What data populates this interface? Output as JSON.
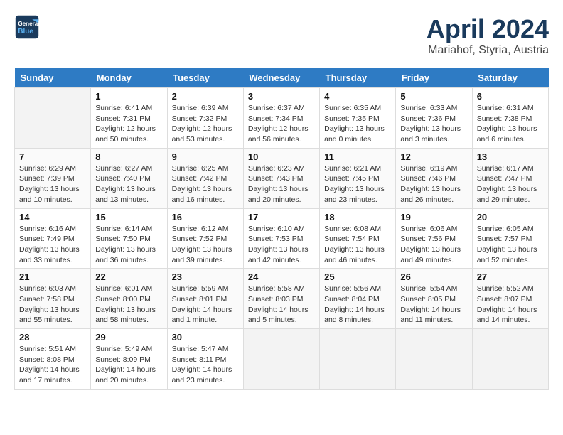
{
  "header": {
    "logo": {
      "line1": "General",
      "line2": "Blue"
    },
    "title": "April 2024",
    "location": "Mariahof, Styria, Austria"
  },
  "weekdays": [
    "Sunday",
    "Monday",
    "Tuesday",
    "Wednesday",
    "Thursday",
    "Friday",
    "Saturday"
  ],
  "weeks": [
    [
      {
        "day": null
      },
      {
        "day": "1",
        "sunrise": "Sunrise: 6:41 AM",
        "sunset": "Sunset: 7:31 PM",
        "daylight": "Daylight: 12 hours and 50 minutes."
      },
      {
        "day": "2",
        "sunrise": "Sunrise: 6:39 AM",
        "sunset": "Sunset: 7:32 PM",
        "daylight": "Daylight: 12 hours and 53 minutes."
      },
      {
        "day": "3",
        "sunrise": "Sunrise: 6:37 AM",
        "sunset": "Sunset: 7:34 PM",
        "daylight": "Daylight: 12 hours and 56 minutes."
      },
      {
        "day": "4",
        "sunrise": "Sunrise: 6:35 AM",
        "sunset": "Sunset: 7:35 PM",
        "daylight": "Daylight: 13 hours and 0 minutes."
      },
      {
        "day": "5",
        "sunrise": "Sunrise: 6:33 AM",
        "sunset": "Sunset: 7:36 PM",
        "daylight": "Daylight: 13 hours and 3 minutes."
      },
      {
        "day": "6",
        "sunrise": "Sunrise: 6:31 AM",
        "sunset": "Sunset: 7:38 PM",
        "daylight": "Daylight: 13 hours and 6 minutes."
      }
    ],
    [
      {
        "day": "7",
        "sunrise": "Sunrise: 6:29 AM",
        "sunset": "Sunset: 7:39 PM",
        "daylight": "Daylight: 13 hours and 10 minutes."
      },
      {
        "day": "8",
        "sunrise": "Sunrise: 6:27 AM",
        "sunset": "Sunset: 7:40 PM",
        "daylight": "Daylight: 13 hours and 13 minutes."
      },
      {
        "day": "9",
        "sunrise": "Sunrise: 6:25 AM",
        "sunset": "Sunset: 7:42 PM",
        "daylight": "Daylight: 13 hours and 16 minutes."
      },
      {
        "day": "10",
        "sunrise": "Sunrise: 6:23 AM",
        "sunset": "Sunset: 7:43 PM",
        "daylight": "Daylight: 13 hours and 20 minutes."
      },
      {
        "day": "11",
        "sunrise": "Sunrise: 6:21 AM",
        "sunset": "Sunset: 7:45 PM",
        "daylight": "Daylight: 13 hours and 23 minutes."
      },
      {
        "day": "12",
        "sunrise": "Sunrise: 6:19 AM",
        "sunset": "Sunset: 7:46 PM",
        "daylight": "Daylight: 13 hours and 26 minutes."
      },
      {
        "day": "13",
        "sunrise": "Sunrise: 6:17 AM",
        "sunset": "Sunset: 7:47 PM",
        "daylight": "Daylight: 13 hours and 29 minutes."
      }
    ],
    [
      {
        "day": "14",
        "sunrise": "Sunrise: 6:16 AM",
        "sunset": "Sunset: 7:49 PM",
        "daylight": "Daylight: 13 hours and 33 minutes."
      },
      {
        "day": "15",
        "sunrise": "Sunrise: 6:14 AM",
        "sunset": "Sunset: 7:50 PM",
        "daylight": "Daylight: 13 hours and 36 minutes."
      },
      {
        "day": "16",
        "sunrise": "Sunrise: 6:12 AM",
        "sunset": "Sunset: 7:52 PM",
        "daylight": "Daylight: 13 hours and 39 minutes."
      },
      {
        "day": "17",
        "sunrise": "Sunrise: 6:10 AM",
        "sunset": "Sunset: 7:53 PM",
        "daylight": "Daylight: 13 hours and 42 minutes."
      },
      {
        "day": "18",
        "sunrise": "Sunrise: 6:08 AM",
        "sunset": "Sunset: 7:54 PM",
        "daylight": "Daylight: 13 hours and 46 minutes."
      },
      {
        "day": "19",
        "sunrise": "Sunrise: 6:06 AM",
        "sunset": "Sunset: 7:56 PM",
        "daylight": "Daylight: 13 hours and 49 minutes."
      },
      {
        "day": "20",
        "sunrise": "Sunrise: 6:05 AM",
        "sunset": "Sunset: 7:57 PM",
        "daylight": "Daylight: 13 hours and 52 minutes."
      }
    ],
    [
      {
        "day": "21",
        "sunrise": "Sunrise: 6:03 AM",
        "sunset": "Sunset: 7:58 PM",
        "daylight": "Daylight: 13 hours and 55 minutes."
      },
      {
        "day": "22",
        "sunrise": "Sunrise: 6:01 AM",
        "sunset": "Sunset: 8:00 PM",
        "daylight": "Daylight: 13 hours and 58 minutes."
      },
      {
        "day": "23",
        "sunrise": "Sunrise: 5:59 AM",
        "sunset": "Sunset: 8:01 PM",
        "daylight": "Daylight: 14 hours and 1 minute."
      },
      {
        "day": "24",
        "sunrise": "Sunrise: 5:58 AM",
        "sunset": "Sunset: 8:03 PM",
        "daylight": "Daylight: 14 hours and 5 minutes."
      },
      {
        "day": "25",
        "sunrise": "Sunrise: 5:56 AM",
        "sunset": "Sunset: 8:04 PM",
        "daylight": "Daylight: 14 hours and 8 minutes."
      },
      {
        "day": "26",
        "sunrise": "Sunrise: 5:54 AM",
        "sunset": "Sunset: 8:05 PM",
        "daylight": "Daylight: 14 hours and 11 minutes."
      },
      {
        "day": "27",
        "sunrise": "Sunrise: 5:52 AM",
        "sunset": "Sunset: 8:07 PM",
        "daylight": "Daylight: 14 hours and 14 minutes."
      }
    ],
    [
      {
        "day": "28",
        "sunrise": "Sunrise: 5:51 AM",
        "sunset": "Sunset: 8:08 PM",
        "daylight": "Daylight: 14 hours and 17 minutes."
      },
      {
        "day": "29",
        "sunrise": "Sunrise: 5:49 AM",
        "sunset": "Sunset: 8:09 PM",
        "daylight": "Daylight: 14 hours and 20 minutes."
      },
      {
        "day": "30",
        "sunrise": "Sunrise: 5:47 AM",
        "sunset": "Sunset: 8:11 PM",
        "daylight": "Daylight: 14 hours and 23 minutes."
      },
      {
        "day": null
      },
      {
        "day": null
      },
      {
        "day": null
      },
      {
        "day": null
      }
    ]
  ]
}
